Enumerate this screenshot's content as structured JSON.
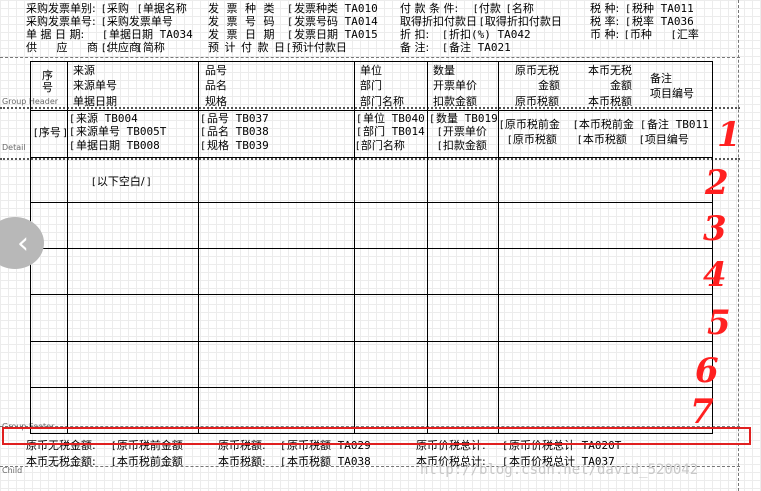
{
  "top_fields": {
    "row1": [
      "采购发票单别:",
      "采购",
      "单据名称",
      "发 票 种 类",
      "发票种类 TA010",
      "付 款 条 件:",
      "付款",
      "名称",
      "税 种:",
      "税种 TA011"
    ],
    "row2": [
      "采购发票单号:",
      "采购发票单号",
      "发 票 号 码",
      "发票号码 TA014",
      "取得折扣付款日",
      "取得折扣付款日",
      "税 率:",
      "税率 TA036"
    ],
    "row3": [
      "单 据 日 期:",
      "单据日期 TA034",
      "发 票 日 期",
      "发票日期 TA015",
      "折 扣:",
      "折扣(%) TA042",
      "币 种:",
      "币种",
      "汇率"
    ],
    "row4": [
      "供 应 商:",
      "供应商",
      "简称",
      "预 计 付 款 日",
      "预计付款日",
      "备 注:",
      "备注 TA021"
    ]
  },
  "bands": {
    "group_header": "Group Header",
    "detail": "Detail",
    "group_footer": "Group Footer",
    "child": "Child"
  },
  "column_headers": {
    "seq": "序号",
    "source": [
      "来源",
      "来源单号",
      "单据日期"
    ],
    "item": [
      "品号",
      "品名",
      "规格"
    ],
    "unit": [
      "单位",
      "部门",
      "部门名称"
    ],
    "qty": [
      "数量",
      "开票单价",
      "扣款金额"
    ],
    "orig": [
      "原币无税",
      "金额",
      "原币税额"
    ],
    "local": [
      "本币无税",
      "金额",
      "本币税额"
    ],
    "remark": [
      "备注",
      "项目编号"
    ]
  },
  "detail_fields": {
    "seq": "序号",
    "source": [
      "来源 TB004",
      "来源单号 TB005T",
      "单据日期 TB008"
    ],
    "item": [
      "品号 TB037",
      "品名 TB038",
      "规格 TB039"
    ],
    "unit": [
      "单位 TB040",
      "部门 TB014",
      "部门名称"
    ],
    "qty": [
      "数量 TB019",
      "开票单价",
      "扣款金额"
    ],
    "orig": [
      "原币税前金",
      "原币税额"
    ],
    "local": [
      "本币税前金",
      "本币税额"
    ],
    "remark": [
      "备注 TB011",
      "项目编号"
    ]
  },
  "blank_text": "以下空白/",
  "annotations": [
    "1",
    "2",
    "3",
    "4",
    "5",
    "6",
    "7"
  ],
  "footer": {
    "row1": [
      "原币无税金额:",
      "原币税前金额",
      "原币税额:",
      "原币税额 TA029",
      "原币价税总计:",
      "原币价税总计 TA020T"
    ],
    "row2": [
      "本币无税金额:",
      "本币税前金额",
      "本币税额:",
      "本币税额 TA038",
      "本币价税总计:",
      "本币价税总计 TA037"
    ]
  },
  "watermark": "http://blog.csdn.net/david_520042",
  "nav_icon": "chevron-left-icon",
  "colors": {
    "highlight": "#e02020",
    "annotation": "#ff2020",
    "nav": "#b8b8b8"
  }
}
